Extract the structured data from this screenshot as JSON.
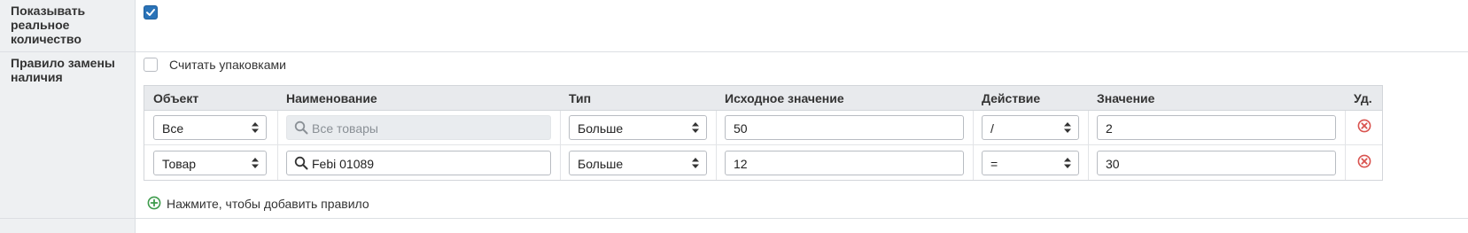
{
  "settings": {
    "show_real_qty": {
      "label": "Показывать реальное количество",
      "checked": true
    },
    "availability_rule": {
      "label": "Правило замены наличия"
    },
    "count_packages": {
      "label": "Считать упаковками",
      "checked": false
    }
  },
  "table": {
    "columns": [
      "Объект",
      "Наименование",
      "Тип",
      "Исходное значение",
      "Действие",
      "Значение",
      "Уд."
    ],
    "rows": [
      {
        "object": "Все",
        "name": "Все товары",
        "name_disabled": true,
        "type": "Больше",
        "source": "50",
        "action": "/",
        "value": "2"
      },
      {
        "object": "Товар",
        "name": "Febi 01089",
        "name_disabled": false,
        "type": "Больше",
        "source": "12",
        "action": "=",
        "value": "30"
      }
    ]
  },
  "add_rule": {
    "label": "Нажмите, чтобы добавить правило",
    "icon": "plus-circle-icon"
  },
  "colors": {
    "accent": "#2a73b8",
    "delete": "#d9534f",
    "add": "#3d9b4b"
  }
}
